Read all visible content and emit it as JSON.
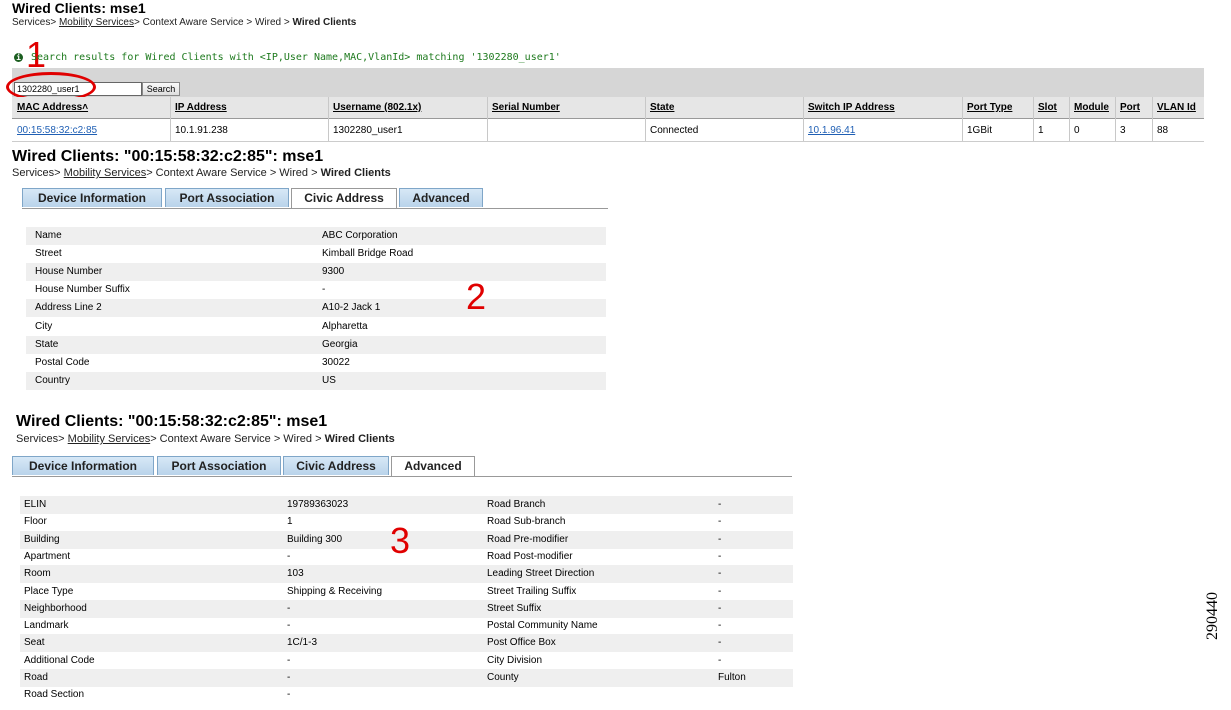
{
  "section1": {
    "title": "Wired Clients: mse1",
    "breadcrumb": {
      "p1": "Services>",
      "p2": "Mobility Services",
      "p3": "> Context Aware Service > Wired >",
      "p4": "Wired Clients"
    },
    "annotation": "1",
    "message": "Search results for Wired Clients with <IP,User Name,MAC,VlanId> matching '1302280_user1'",
    "search_value": "1302280_user1",
    "search_label": "Search",
    "columns": [
      "MAC Address˄",
      "IP Address",
      "Username (802.1x)",
      "Serial Number",
      "State",
      "Switch IP Address",
      "Port Type",
      "Slot",
      "Module",
      "Port",
      "VLAN Id"
    ],
    "row": [
      "00:15:58:32:c2:85",
      "10.1.91.238",
      "1302280_user1",
      "",
      "Connected",
      "10.1.96.41",
      "1GBit",
      "1",
      "0",
      "3",
      "88"
    ]
  },
  "section2": {
    "title": "Wired Clients: \"00:15:58:32:c2:85\": mse1",
    "breadcrumb": {
      "p1": "Services>",
      "p2": "Mobility Services",
      "p3": "> Context Aware Service > Wired >",
      "p4": "Wired Clients"
    },
    "tabs": [
      "Device Information",
      "Port Association",
      "Civic Address",
      "Advanced"
    ],
    "active_tab": "Civic Address",
    "annotation": "2",
    "fields": [
      [
        "Name",
        "ABC Corporation"
      ],
      [
        "Street",
        "Kimball Bridge Road"
      ],
      [
        "House Number",
        "9300"
      ],
      [
        "House Number Suffix",
        "-"
      ],
      [
        "Address Line 2",
        "A10-2 Jack 1"
      ],
      [
        "City",
        "Alpharetta"
      ],
      [
        "State",
        "Georgia"
      ],
      [
        "Postal Code",
        "30022"
      ],
      [
        "Country",
        "US"
      ]
    ]
  },
  "section3": {
    "title": "Wired Clients: \"00:15:58:32:c2:85\": mse1",
    "breadcrumb": {
      "p1": "Services>",
      "p2": "Mobility Services",
      "p3": "> Context Aware Service > Wired >",
      "p4": "Wired Clients"
    },
    "tabs": [
      "Device Information",
      "Port Association",
      "Civic Address",
      "Advanced"
    ],
    "active_tab": "Advanced",
    "annotation": "3",
    "left_fields": [
      [
        "ELIN",
        "19789363023"
      ],
      [
        "Floor",
        "1"
      ],
      [
        "Building",
        "Building 300"
      ],
      [
        "Apartment",
        "-"
      ],
      [
        "Room",
        "103"
      ],
      [
        "Place Type",
        "Shipping & Receiving"
      ],
      [
        "Neighborhood",
        "-"
      ],
      [
        "Landmark",
        "-"
      ],
      [
        "Seat",
        "1C/1-3"
      ],
      [
        "Additional Code",
        "-"
      ],
      [
        "Road",
        "-"
      ],
      [
        "Road Section",
        "-"
      ]
    ],
    "right_fields": [
      [
        "Road Branch",
        "-"
      ],
      [
        "Road Sub-branch",
        "-"
      ],
      [
        "Road Pre-modifier",
        "-"
      ],
      [
        "Road Post-modifier",
        "-"
      ],
      [
        "Leading Street Direction",
        "-"
      ],
      [
        "Street Trailing Suffix",
        "-"
      ],
      [
        "Street Suffix",
        "-"
      ],
      [
        "Postal Community Name",
        "-"
      ],
      [
        "Post Office Box",
        "-"
      ],
      [
        "City Division",
        "-"
      ],
      [
        "County",
        "Fulton"
      ]
    ]
  },
  "figure_code": "290440",
  "colors": {
    "annotation": "#e00000",
    "message": "#1e7a1e",
    "link": "#1f5fb4",
    "tab": "#c8dcee"
  }
}
